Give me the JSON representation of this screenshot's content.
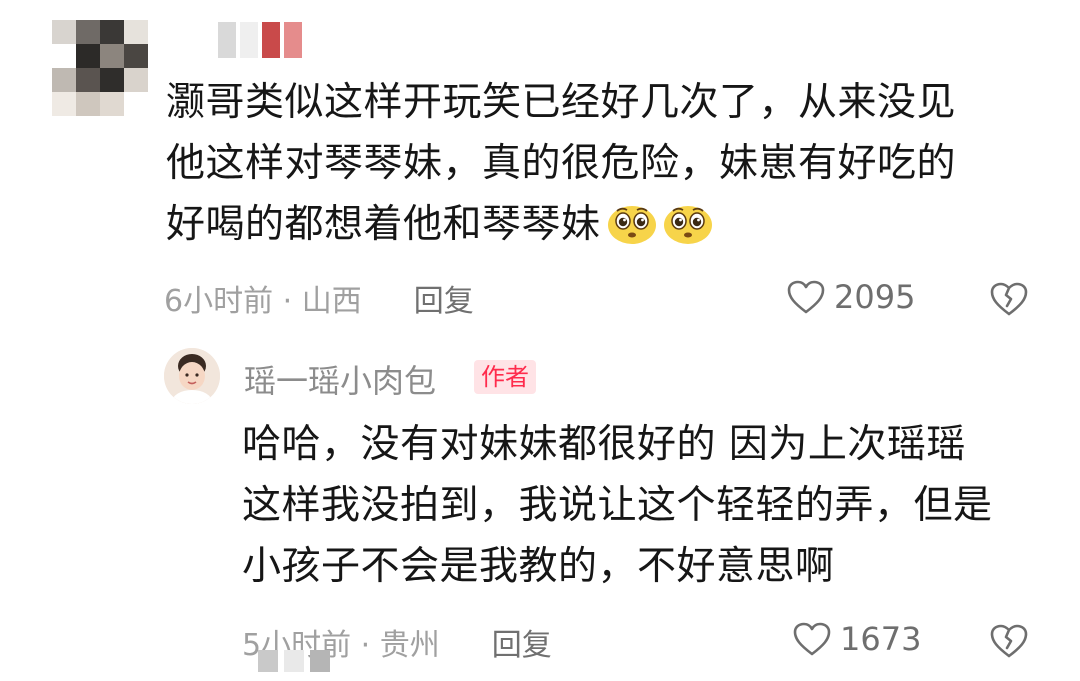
{
  "top_comment": {
    "lines": [
      "灏哥类似这样开玩笑已经好几次了，从来没见",
      "他这样对琴琴妹，真的很危险，妹崽有好吃的",
      "好喝的都想着他和琴琴妹"
    ],
    "emoji": [
      "pleading-face-emoji",
      "pleading-face-emoji"
    ],
    "time_location": "6小时前 · 山西",
    "reply_label": "回复",
    "like_count": "2095"
  },
  "reply": {
    "username": "瑶一瑶小肉包",
    "badge": "作者",
    "lines": [
      "哈哈，没有对妹妹都很好的 因为上次瑶瑶",
      "这样我没拍到，我说让这个轻轻的弄，但是",
      "小孩子不会是我教的，不好意思啊"
    ],
    "time_location": "5小时前 · 贵州",
    "reply_label": "回复",
    "like_count": "1673"
  },
  "colors": {
    "text": "#161616",
    "meta": "#9b9b9b",
    "badge_bg": "#ffe3e6",
    "badge_text": "#ff2b4c"
  }
}
